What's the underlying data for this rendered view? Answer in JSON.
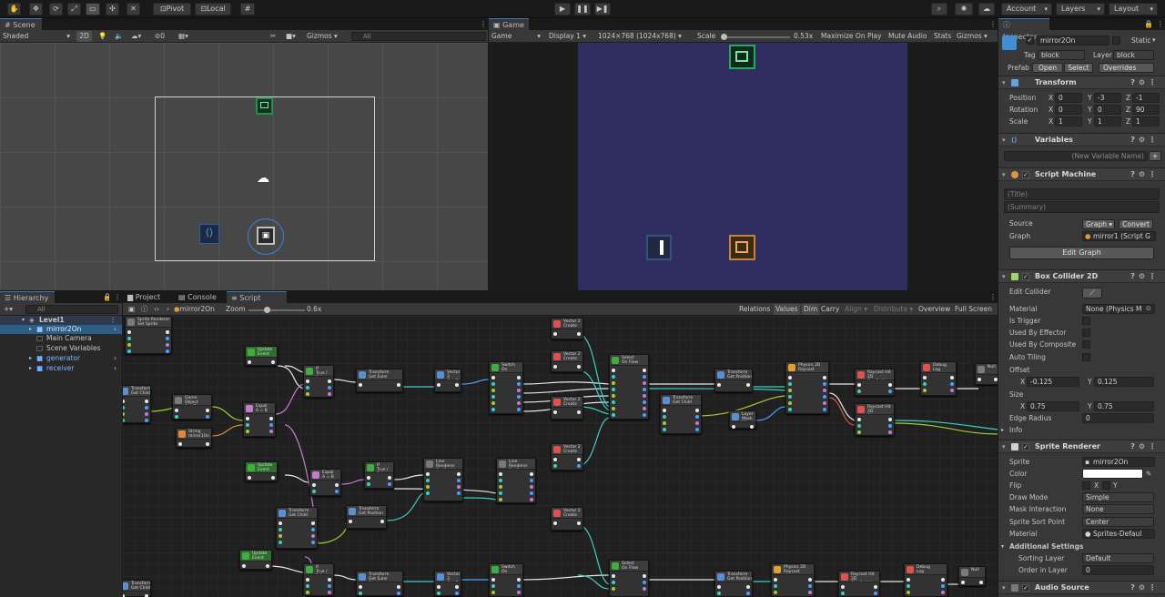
{
  "toolbar": {
    "pivot": "Pivot",
    "local": "Local",
    "account": "Account",
    "layers": "Layers",
    "layout": "Layout"
  },
  "scene": {
    "tab": "Scene",
    "shading": "Shaded",
    "mode_2d": "2D",
    "hidden_count": "0",
    "gizmos": "Gizmos",
    "search_placeholder": "All"
  },
  "game": {
    "tab": "Game",
    "view": "Game",
    "display": "Display 1",
    "resolution": "1024×768 (1024x768)",
    "scale_label": "Scale",
    "scale_value": "0.53x",
    "maximize": "Maximize On Play",
    "mute": "Mute Audio",
    "stats": "Stats",
    "gizmos": "Gizmos"
  },
  "inspector": {
    "tab": "Inspector",
    "object_name": "mirror2On",
    "static_label": "Static",
    "tag_label": "Tag",
    "tag_value": "block",
    "layer_label": "Layer",
    "layer_value": "block",
    "prefab_label": "Prefab",
    "open": "Open",
    "select": "Select",
    "overrides": "Overrides",
    "transform": {
      "title": "Transform",
      "position_label": "Position",
      "rotation_label": "Rotation",
      "scale_label": "Scale",
      "position": [
        "0",
        "-3",
        "-1"
      ],
      "rotation": [
        "0",
        "0",
        "90"
      ],
      "scale": [
        "1",
        "1",
        "1"
      ]
    },
    "variables": {
      "title": "Variables",
      "new_var_placeholder": "(New Variable Name)"
    },
    "script_machine": {
      "title": "Script Machine",
      "title_field": "(Title)",
      "summary_field": "(Summary)",
      "source_label": "Source",
      "source_value": "Graph",
      "convert": "Convert",
      "graph_label": "Graph",
      "graph_value": "mirror1 (Script G",
      "edit_graph": "Edit Graph"
    },
    "box_collider": {
      "title": "Box Collider 2D",
      "edit_collider": "Edit Collider",
      "material_label": "Material",
      "material_value": "None (Physics M",
      "is_trigger": "Is Trigger",
      "used_by_effector": "Used By Effector",
      "used_by_composite": "Used By Composite",
      "auto_tiling": "Auto Tiling",
      "offset_label": "Offset",
      "offset_x": "-0.125",
      "offset_y": "0.125",
      "size_label": "Size",
      "size_x": "0.75",
      "size_y": "0.75",
      "edge_radius_label": "Edge Radius",
      "edge_radius": "0",
      "info": "Info"
    },
    "sprite_renderer": {
      "title": "Sprite Renderer",
      "sprite_label": "Sprite",
      "sprite_value": "mirror2On",
      "color_label": "Color",
      "flip_label": "Flip",
      "flip_x": "X",
      "flip_y": "Y",
      "draw_mode_label": "Draw Mode",
      "draw_mode": "Simple",
      "mask_label": "Mask Interaction",
      "mask": "None",
      "sort_point_label": "Sprite Sort Point",
      "sort_point": "Center",
      "material_label": "Material",
      "material": "Sprites-Defaul",
      "additional": "Additional Settings",
      "sorting_layer_label": "Sorting Layer",
      "sorting_layer": "Default",
      "order_label": "Order in Layer",
      "order": "0"
    },
    "audio_source": {
      "title": "Audio Source"
    }
  },
  "hierarchy": {
    "tab": "Hierarchy",
    "search_placeholder": "All",
    "items": [
      "Level1",
      "mirror2On",
      "Main Camera",
      "Scene Variables",
      "generator",
      "receiver"
    ]
  },
  "graph_panel": {
    "tabs": [
      "Project",
      "Console",
      "Script Graph"
    ],
    "graph_name": "mirror2On",
    "zoom_label": "Zoom",
    "zoom_value": "0.6x",
    "relations": "Relations",
    "values": "Values",
    "dim": "Dim",
    "carry": "Carry",
    "align": "Align",
    "distribute": "Distribute",
    "overview": "Overview",
    "full_screen": "Full Screen"
  },
  "nodes": [
    {
      "id": "n0",
      "t1": "Sprite Renderer",
      "t2": "Set Sprite",
      "c": "#7a7a7a"
    },
    {
      "id": "n1",
      "t1": "Transform",
      "t2": "Get Child",
      "c": "#5a8fd0"
    },
    {
      "id": "n2",
      "t1": "Update",
      "t2": "Event",
      "c": "#3fae3f"
    },
    {
      "id": "n3",
      "t1": "Game Object",
      "t2": "Get Tag",
      "c": "#7a7a7a"
    },
    {
      "id": "n4",
      "t1": "Equal",
      "t2": "A = B",
      "c": "#c57bd1"
    },
    {
      "id": "n5",
      "t1": "String",
      "t2": "mirror1On",
      "c": "#e08a3a"
    },
    {
      "id": "n6",
      "t1": "If",
      "t2": "True / False",
      "c": "#3fae3f"
    },
    {
      "id": "n7",
      "t1": "Transform",
      "t2": "Get Euler Angles",
      "c": "#5a8fd0"
    },
    {
      "id": "n8",
      "t1": "Vector 3",
      "t2": "Get Z",
      "c": "#5a8fd0"
    },
    {
      "id": "n9",
      "t1": "Switch",
      "t2": "On Integer",
      "c": "#3fae3f"
    },
    {
      "id": "n10",
      "t1": "Vector 2",
      "t2": "Create",
      "c": "#e05050"
    },
    {
      "id": "n11",
      "t1": "Vector 2",
      "t2": "Create",
      "c": "#e05050"
    },
    {
      "id": "n12",
      "t1": "Vector 2",
      "t2": "Create",
      "c": "#e05050"
    },
    {
      "id": "n13",
      "t1": "Select",
      "t2": "On Flow",
      "c": "#3fae3f"
    },
    {
      "id": "n14",
      "t1": "Transform",
      "t2": "Get Child",
      "c": "#5a8fd0"
    },
    {
      "id": "n15",
      "t1": "Transform",
      "t2": "Get Position",
      "c": "#5a8fd0"
    },
    {
      "id": "n16",
      "t1": "Layer Mask",
      "t2": "MirrorLine",
      "c": "#5a8fd0"
    },
    {
      "id": "n17",
      "t1": "Physics 2D",
      "t2": "Raycast",
      "c": "#e0a030"
    },
    {
      "id": "n18",
      "t1": "Raycast Hit 2D",
      "t2": "Get Collider",
      "c": "#e05050"
    },
    {
      "id": "n19",
      "t1": "Raycast Hit 2D",
      "t2": "Get Distance",
      "c": "#e05050"
    },
    {
      "id": "n20",
      "t1": "Debug",
      "t2": "Log",
      "c": "#e05050"
    },
    {
      "id": "n21",
      "t1": "Update",
      "t2": "Event",
      "c": "#3fae3f"
    },
    {
      "id": "n22",
      "t1": "Equal",
      "t2": "A = B",
      "c": "#c57bd1"
    },
    {
      "id": "n23",
      "t1": "If",
      "t2": "True / False",
      "c": "#3fae3f"
    },
    {
      "id": "n24",
      "t1": "Line Renderer",
      "t2": "Set Position",
      "c": "#7a7a7a"
    },
    {
      "id": "n25",
      "t1": "Line Renderer",
      "t2": "Set Position",
      "c": "#7a7a7a"
    },
    {
      "id": "n26",
      "t1": "Transform",
      "t2": "Get Position",
      "c": "#5a8fd0"
    },
    {
      "id": "n27",
      "t1": "Transform",
      "t2": "Get Child",
      "c": "#5a8fd0"
    },
    {
      "id": "n28",
      "t1": "Update",
      "t2": "Event",
      "c": "#3fae3f"
    },
    {
      "id": "n29",
      "t1": "Vector 2",
      "t2": "Create",
      "c": "#e05050"
    },
    {
      "id": "n30",
      "t1": "Vector 2",
      "t2": "Create",
      "c": "#e05050"
    },
    {
      "id": "n31",
      "t1": "If",
      "t2": "True / False",
      "c": "#3fae3f"
    },
    {
      "id": "n32",
      "t1": "Transform",
      "t2": "Get Euler Angles",
      "c": "#5a8fd0"
    },
    {
      "id": "n33",
      "t1": "Vector 3",
      "t2": "Get Z",
      "c": "#5a8fd0"
    },
    {
      "id": "n34",
      "t1": "Switch",
      "t2": "On Integer",
      "c": "#3fae3f"
    },
    {
      "id": "n35",
      "t1": "Select",
      "t2": "On Flow",
      "c": "#3fae3f"
    },
    {
      "id": "n36",
      "t1": "Transform",
      "t2": "Get Position",
      "c": "#5a8fd0"
    },
    {
      "id": "n37",
      "t1": "Physics 2D",
      "t2": "Raycast",
      "c": "#e0a030"
    },
    {
      "id": "n38",
      "t1": "Raycast Hit 2D",
      "t2": "Get Collider",
      "c": "#e05050"
    },
    {
      "id": "n39",
      "t1": "Debug",
      "t2": "Log",
      "c": "#e05050"
    },
    {
      "id": "n40",
      "t1": "Transform",
      "t2": "Get Child",
      "c": "#5a8fd0"
    },
    {
      "id": "n41",
      "t1": "Null",
      "t2": "",
      "c": "#7a7a7a"
    },
    {
      "id": "n42",
      "t1": "Null",
      "t2": "",
      "c": "#7a7a7a"
    }
  ]
}
